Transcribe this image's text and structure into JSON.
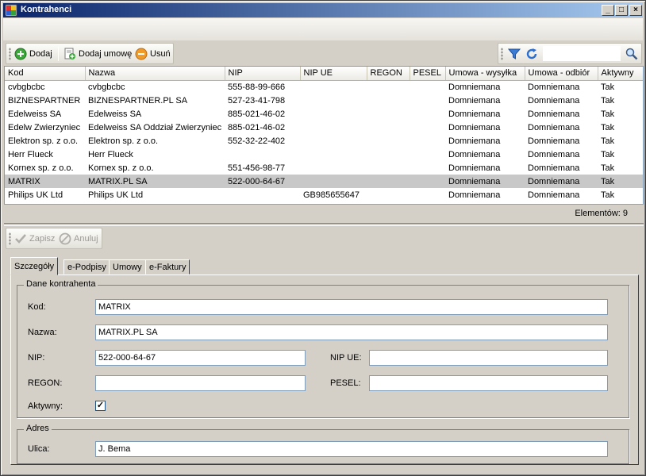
{
  "window": {
    "title": "Kontrahenci"
  },
  "toolbar": {
    "add_label": "Dodaj",
    "add_contract_label": "Dodaj umowę",
    "delete_label": "Usuń",
    "search_value": ""
  },
  "grid": {
    "columns": [
      "Kod",
      "Nazwa",
      "NIP",
      "NIP UE",
      "REGON",
      "PESEL",
      "Umowa - wysyłka",
      "Umowa - odbiór",
      "Aktywny"
    ],
    "rows": [
      [
        "cvbgbcbc",
        "cvbgbcbc",
        "555-88-99-666",
        "",
        "",
        "",
        "Domniemana",
        "Domniemana",
        "Tak"
      ],
      [
        "BIZNESPARTNER",
        "BIZNESPARTNER.PL SA",
        "527-23-41-798",
        "",
        "",
        "",
        "Domniemana",
        "Domniemana",
        "Tak"
      ],
      [
        "Edelweiss SA",
        "Edelweiss SA",
        "885-021-46-02",
        "",
        "",
        "",
        "Domniemana",
        "Domniemana",
        "Tak"
      ],
      [
        "Edelw Zwierzyniec",
        "Edelweiss SA Oddział Zwierzyniec",
        "885-021-46-02",
        "",
        "",
        "",
        "Domniemana",
        "Domniemana",
        "Tak"
      ],
      [
        "Elektron sp. z o.o.",
        "Elektron sp. z o.o.",
        "552-32-22-402",
        "",
        "",
        "",
        "Domniemana",
        "Domniemana",
        "Tak"
      ],
      [
        "Herr Flueck",
        "Herr Flueck",
        "",
        "",
        "",
        "",
        "Domniemana",
        "Domniemana",
        "Tak"
      ],
      [
        "Kornex sp. z o.o.",
        "Kornex sp. z o.o.",
        "551-456-98-77",
        "",
        "",
        "",
        "Domniemana",
        "Domniemana",
        "Tak"
      ],
      [
        "MATRIX",
        "MATRIX.PL SA",
        "522-000-64-67",
        "",
        "",
        "",
        "Domniemana",
        "Domniemana",
        "Tak"
      ],
      [
        "Philips UK Ltd",
        "Philips UK Ltd",
        "",
        "GB985655647",
        "",
        "",
        "Domniemana",
        "Domniemana",
        "Tak"
      ]
    ],
    "selected_row": 7,
    "footer_count": "Elementów: 9"
  },
  "edit_toolbar": {
    "save_label": "Zapisz",
    "cancel_label": "Anuluj"
  },
  "tabs": [
    "Szczegóły",
    "e-Podpisy",
    "Umowy",
    "e-Faktury"
  ],
  "active_tab": 0,
  "details": {
    "group_title": "Dane kontrahenta",
    "kod_label": "Kod:",
    "kod_value": "MATRIX",
    "nazwa_label": "Nazwa:",
    "nazwa_value": "MATRIX.PL SA",
    "nip_label": "NIP:",
    "nip_value": "522-000-64-67",
    "nipue_label": "NIP UE:",
    "nipue_value": "",
    "regon_label": "REGON:",
    "regon_value": "",
    "pesel_label": "PESEL:",
    "pesel_value": "",
    "aktywny_label": "Aktywny:",
    "aktywny_checked": true
  },
  "address": {
    "group_title": "Adres",
    "ulica_label": "Ulica:",
    "ulica_value": "J. Bema"
  },
  "colors": {
    "title_start": "#0a246a",
    "title_end": "#a6caf0",
    "selected_row": "#c8c8c8"
  }
}
